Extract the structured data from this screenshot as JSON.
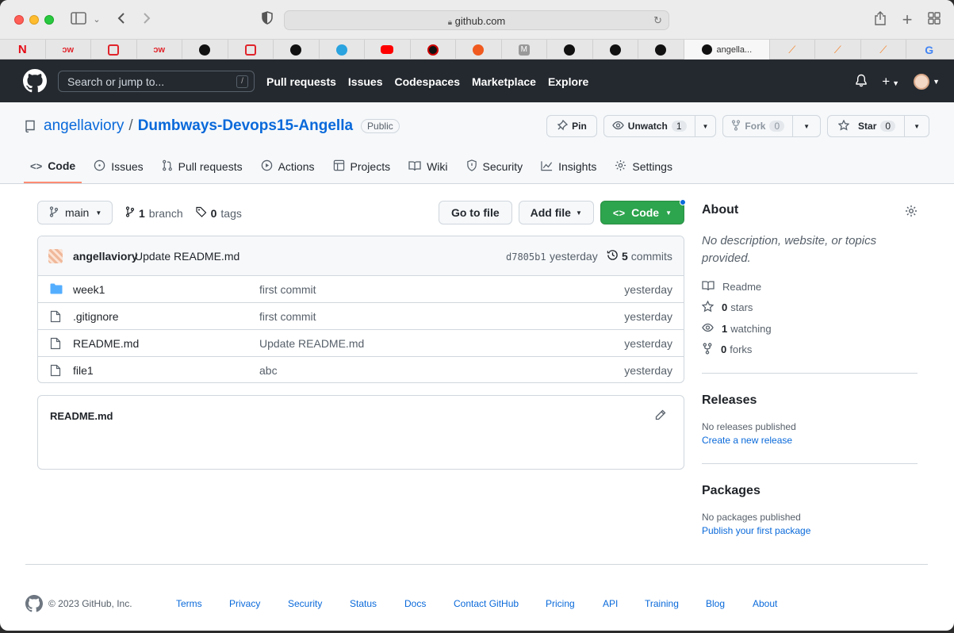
{
  "browser": {
    "url": "github.com",
    "active_tab_title": "angella...",
    "favorites": [
      "netflix",
      "dw",
      "dev",
      "dw",
      "github",
      "dev",
      "github",
      "telegram",
      "youtube",
      "zoom",
      "dots",
      "m",
      "github",
      "github",
      "github",
      "active",
      "stack",
      "stack",
      "stack",
      "google"
    ]
  },
  "header": {
    "search_placeholder": "Search or jump to...",
    "slash": "/",
    "nav": [
      "Pull requests",
      "Issues",
      "Codespaces",
      "Marketplace",
      "Explore"
    ]
  },
  "repo": {
    "owner": "angellaviory",
    "sep": "/",
    "name": "Dumbways-Devops15-Angella",
    "visibility": "Public",
    "pin_label": "Pin",
    "unwatch_label": "Unwatch",
    "unwatch_count": "1",
    "fork_label": "Fork",
    "fork_count": "0",
    "star_label": "Star",
    "star_count": "0"
  },
  "tabs": [
    "Code",
    "Issues",
    "Pull requests",
    "Actions",
    "Projects",
    "Wiki",
    "Security",
    "Insights",
    "Settings"
  ],
  "branch": {
    "name": "main",
    "branch_count": "1",
    "branch_word": "branch",
    "tag_count": "0",
    "tag_word": "tags",
    "goto_file": "Go to file",
    "add_file": "Add file",
    "code": "Code"
  },
  "latest_commit": {
    "author": "angellaviory",
    "message": "Update README.md",
    "sha": "d7805b1",
    "age": "yesterday",
    "commit_count": "5",
    "commit_word": "commits"
  },
  "files": [
    {
      "type": "folder",
      "name": "week1",
      "message": "first commit",
      "age": "yesterday"
    },
    {
      "type": "file",
      "name": ".gitignore",
      "message": "first commit",
      "age": "yesterday"
    },
    {
      "type": "file",
      "name": "README.md",
      "message": "Update README.md",
      "age": "yesterday"
    },
    {
      "type": "file",
      "name": "file1",
      "message": "abc",
      "age": "yesterday"
    }
  ],
  "readme": {
    "title": "README.md"
  },
  "about": {
    "title": "About",
    "description": "No description, website, or topics provided.",
    "readme": "Readme",
    "stars_count": "0",
    "stars_word": "stars",
    "watching_count": "1",
    "watching_word": "watching",
    "forks_count": "0",
    "forks_word": "forks"
  },
  "releases": {
    "title": "Releases",
    "empty": "No releases published",
    "link": "Create a new release"
  },
  "packages": {
    "title": "Packages",
    "empty": "No packages published",
    "link": "Publish your first package"
  },
  "footer": {
    "copyright": "© 2023 GitHub, Inc.",
    "links": [
      "Terms",
      "Privacy",
      "Security",
      "Status",
      "Docs",
      "Contact GitHub",
      "Pricing",
      "API",
      "Training",
      "Blog",
      "About"
    ]
  }
}
